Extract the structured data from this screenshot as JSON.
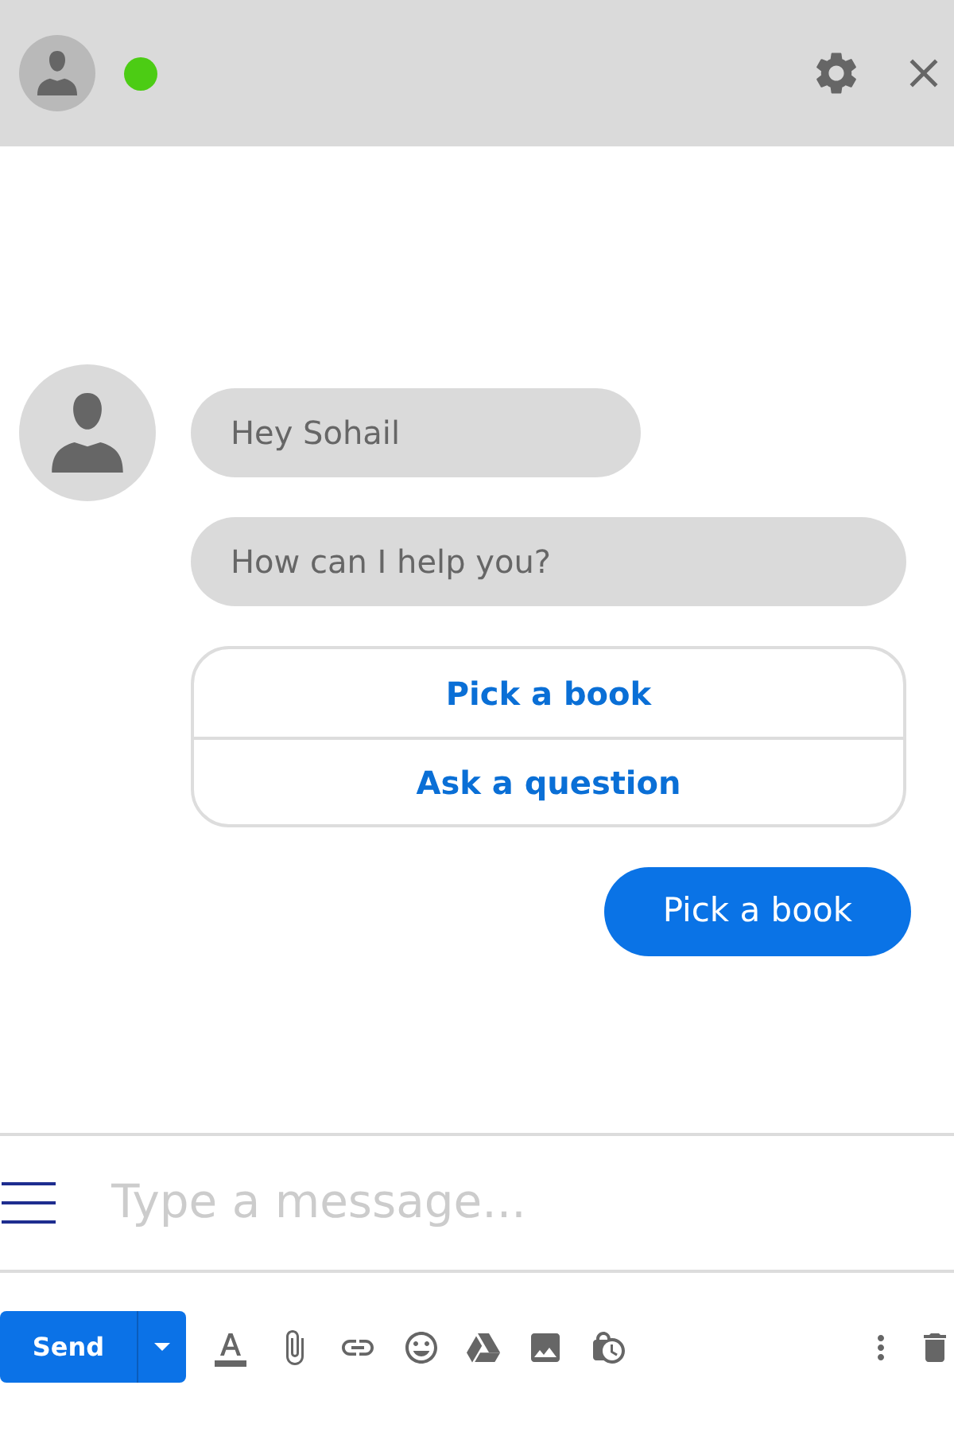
{
  "header": {
    "online": true
  },
  "messages": [
    {
      "kind": "received",
      "text": "Hey Sohail"
    },
    {
      "kind": "received",
      "text": "How can I help you?"
    },
    {
      "kind": "choices",
      "options": [
        {
          "label": "Pick a book"
        },
        {
          "label": "Ask a question"
        }
      ]
    },
    {
      "kind": "sent",
      "text": "Pick a book"
    }
  ],
  "composer": {
    "placeholder": "Type a message..."
  },
  "toolbar": {
    "send_label": "Send"
  }
}
